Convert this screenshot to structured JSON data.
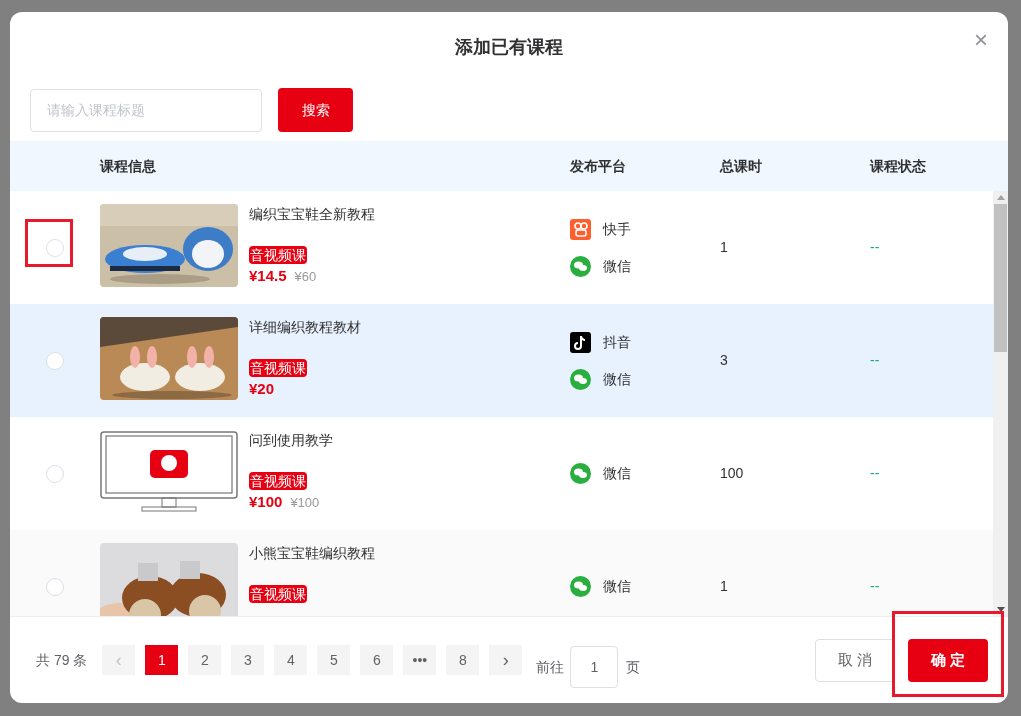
{
  "dialog": {
    "title": "添加已有课程",
    "close": "×"
  },
  "search": {
    "placeholder": "请输入课程标题",
    "button": "搜索"
  },
  "table": {
    "columns": [
      {
        "label": "课程信息"
      },
      {
        "label": "发布平台"
      },
      {
        "label": "总课时"
      },
      {
        "label": "课程状态"
      }
    ],
    "rows": [
      {
        "selected": false,
        "highlighted": true,
        "hovered": false,
        "title": "编织宝宝鞋全新教程",
        "tag": "音视频课",
        "price": "¥14.5",
        "original_price": "¥60",
        "platforms": [
          {
            "kind": "kuaishou",
            "label": "快手"
          },
          {
            "kind": "wechat",
            "label": "微信"
          }
        ],
        "hours": "1",
        "status": "--"
      },
      {
        "selected": false,
        "highlighted": false,
        "hovered": true,
        "title": "详细编织教程教材",
        "tag": "音视频课",
        "price": "¥20",
        "platforms": [
          {
            "kind": "douyin",
            "label": "抖音"
          },
          {
            "kind": "wechat",
            "label": "微信"
          }
        ],
        "hours": "3",
        "status": "--"
      },
      {
        "selected": false,
        "highlighted": false,
        "hovered": false,
        "title": "问到使用教学",
        "tag": "音视频课",
        "price": "¥100",
        "original_price": "¥100",
        "platforms": [
          {
            "kind": "wechat",
            "label": "微信"
          }
        ],
        "hours": "100",
        "status": "--"
      },
      {
        "selected": false,
        "highlighted": false,
        "hovered": false,
        "title": "小熊宝宝鞋编织教程",
        "tag": "音视频课",
        "platforms": [
          {
            "kind": "wechat",
            "label": "微信"
          }
        ],
        "hours": "1",
        "status": "--"
      }
    ]
  },
  "pagination": {
    "total": "共 79 条",
    "prev": "‹",
    "next": "›",
    "pages": [
      {
        "label": "1",
        "selected": true
      },
      {
        "label": "2",
        "selected": false
      },
      {
        "label": "3",
        "selected": false
      },
      {
        "label": "4",
        "selected": false
      },
      {
        "label": "5",
        "selected": false
      },
      {
        "label": "6",
        "selected": false
      },
      {
        "label": "•••",
        "selected": false
      },
      {
        "label": "8",
        "selected": false
      }
    ],
    "goto_label": "前往",
    "goto_value": "1",
    "goto_suffix": "页"
  },
  "buttons": [
    {
      "kind": "cancel",
      "label": "取 消",
      "highlighted": false
    },
    {
      "kind": "confirm",
      "label": "确 定",
      "highlighted": true
    }
  ]
}
